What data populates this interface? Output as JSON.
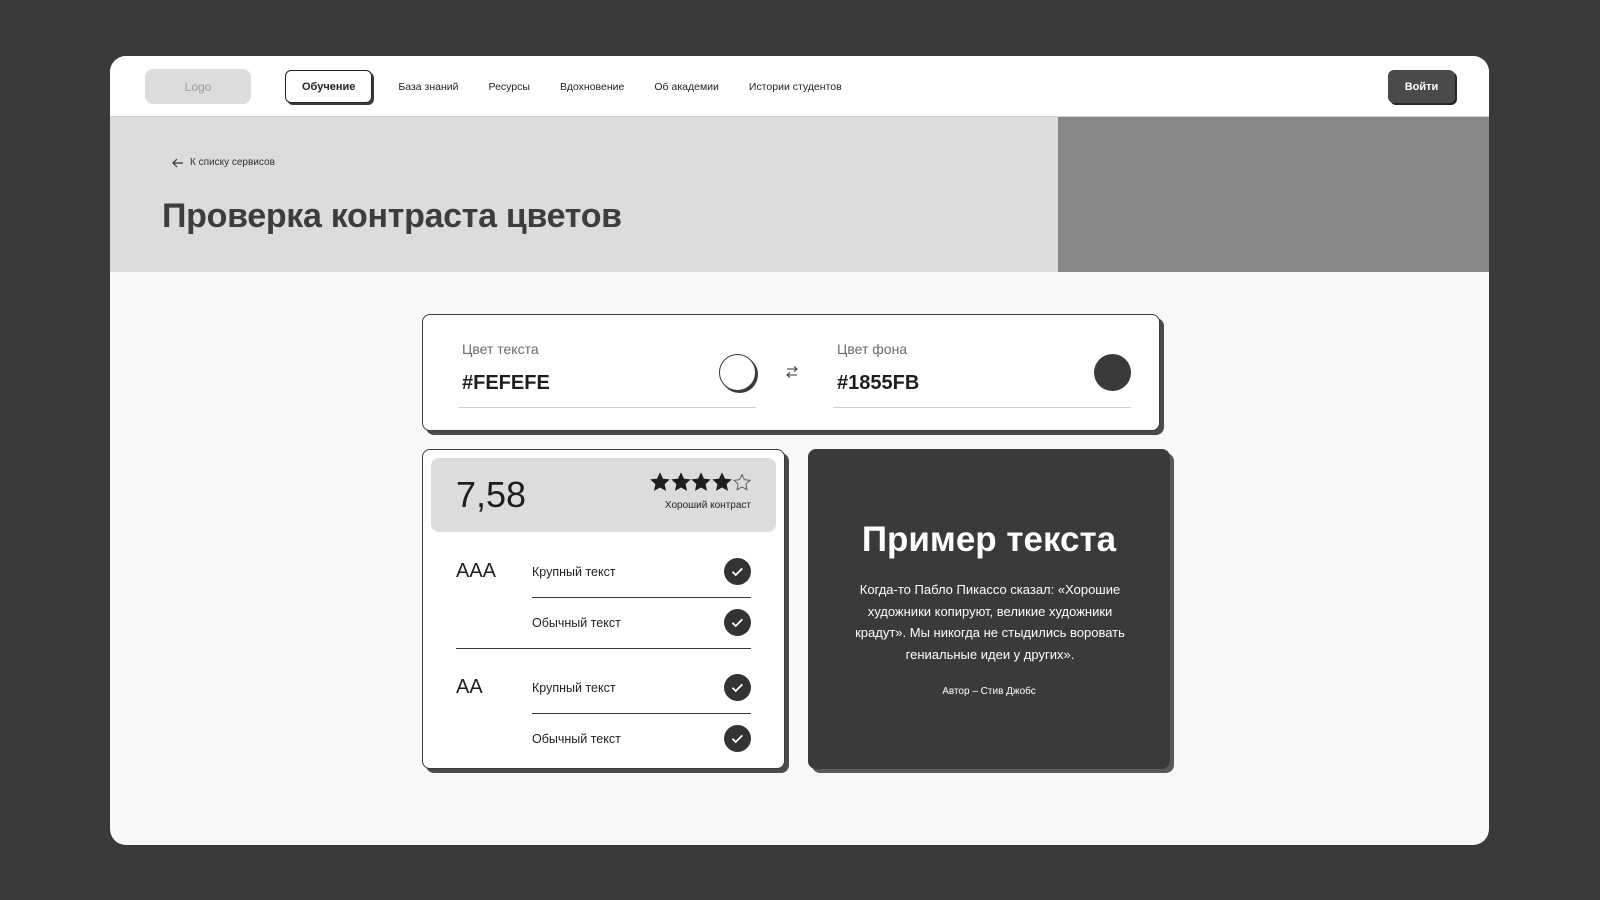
{
  "header": {
    "logo": "Logo",
    "nav": [
      {
        "label": "Обучение",
        "active": true
      },
      {
        "label": "База знаний"
      },
      {
        "label": "Ресурсы"
      },
      {
        "label": "Вдохновение"
      },
      {
        "label": "Об академии"
      },
      {
        "label": "Истории студентов"
      }
    ],
    "login_label": "Войти"
  },
  "hero": {
    "back_label": "К списку сервисов",
    "title": "Проверка контраста цветов"
  },
  "colors": {
    "text_label": "Цвет текста",
    "text_value": "#FEFEFE",
    "bg_label": "Цвет фона",
    "bg_value": "#1855FB",
    "text_swatch_color": "#ffffff",
    "bg_swatch_color": "#3a3a3a"
  },
  "score": {
    "value": "7,58",
    "stars_filled": 4,
    "stars_total": 5,
    "caption": "Хороший контраст"
  },
  "levels": [
    {
      "name": "AAA",
      "rows": [
        {
          "label": "Крупный текст",
          "pass": true
        },
        {
          "label": "Обычный текст",
          "pass": true
        }
      ]
    },
    {
      "name": "AA",
      "rows": [
        {
          "label": "Крупный текст",
          "pass": true
        },
        {
          "label": "Обычный текст",
          "pass": true
        }
      ]
    }
  ],
  "sample": {
    "title": "Пример текста",
    "body": "Когда-то Пабло Пикассо сказал: «Хорошие художники копируют, великие художники крадут». Мы никогда не стыдились воровать гениальные идеи у других».",
    "author": "Автор – Стив Джобс"
  }
}
